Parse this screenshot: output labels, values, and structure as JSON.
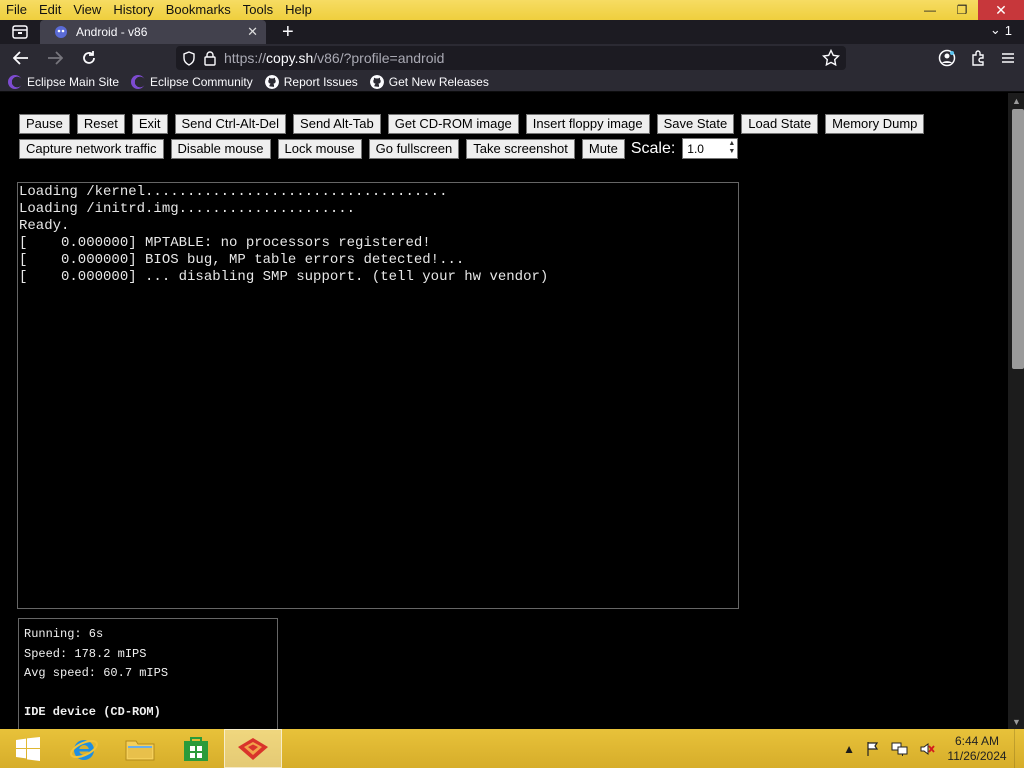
{
  "menu": [
    "File",
    "Edit",
    "View",
    "History",
    "Bookmarks",
    "Tools",
    "Help"
  ],
  "tab": {
    "title": "Android - v86",
    "close": "✕",
    "new": "+",
    "list_count": "1"
  },
  "url": {
    "scheme": "https://",
    "domain": "copy.sh",
    "path": "/v86/?profile=android"
  },
  "bookmarks": [
    {
      "label": "Eclipse Main Site",
      "icon": "eclipse-icon"
    },
    {
      "label": "Eclipse Community",
      "icon": "eclipse-icon"
    },
    {
      "label": "Report Issues",
      "icon": "github-icon"
    },
    {
      "label": "Get New Releases",
      "icon": "github-icon"
    }
  ],
  "toolbar_row1": [
    "Pause",
    "Reset",
    "Exit",
    "Send Ctrl-Alt-Del",
    "Send Alt-Tab",
    "Get CD-ROM image",
    "Insert floppy image",
    "Save State",
    "Load State",
    "Memory Dump"
  ],
  "toolbar_row2": [
    "Capture network traffic",
    "Disable mouse",
    "Lock mouse",
    "Go fullscreen",
    "Take screenshot",
    "Mute"
  ],
  "scale": {
    "label": "Scale:",
    "value": "1.0"
  },
  "screen_lines": [
    "Loading /kernel....................................",
    "Loading /initrd.img.....................",
    "Ready.",
    "[    0.000000] MPTABLE: no processors registered!",
    "[    0.000000] BIOS bug, MP table errors detected!...",
    "[    0.000000] ... disabling SMP support. (tell your hw vendor)"
  ],
  "info": {
    "running": "Running: 6s",
    "speed": "Speed: 178.2 mIPS",
    "avg": "Avg speed: 60.7 mIPS",
    "ide": "IDE device (CD-ROM)"
  },
  "taskbar": {
    "time": "6:44 AM",
    "date": "11/26/2024"
  },
  "colors": {
    "menubar": "#f4d64a",
    "taskbar": "#d9b12e",
    "close": "#c7373b"
  }
}
